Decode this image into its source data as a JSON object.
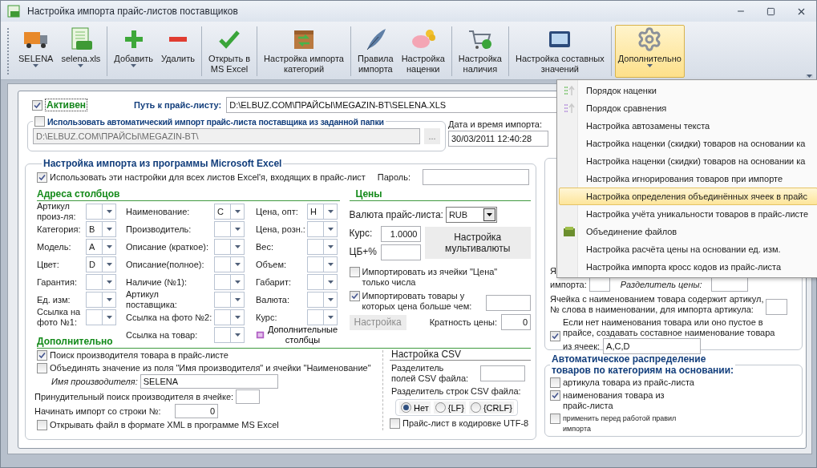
{
  "window": {
    "title": "Настройка импорта прайс-листов поставщиков"
  },
  "toolbar": [
    {
      "kind": "button",
      "label": "SELENA",
      "dropdown": true,
      "selected": false
    },
    {
      "kind": "button",
      "label": "selena.xls",
      "dropdown": true,
      "selected": false
    },
    {
      "kind": "separator"
    },
    {
      "kind": "button",
      "label": "Добавить",
      "dropdown": true,
      "selected": false
    },
    {
      "kind": "button",
      "label": "Удалить",
      "dropdown": false,
      "selected": false
    },
    {
      "kind": "separator"
    },
    {
      "kind": "button",
      "label": "Открыть в\nMS Excel",
      "dropdown": false,
      "selected": false
    },
    {
      "kind": "separator"
    },
    {
      "kind": "button",
      "label": "Настройка импорта\nкатегорий",
      "dropdown": false,
      "selected": false
    },
    {
      "kind": "separator"
    },
    {
      "kind": "button",
      "label": "Правила\nимпорта",
      "dropdown": false,
      "selected": false
    },
    {
      "kind": "button",
      "label": "Настройка\nнаценки",
      "dropdown": false,
      "selected": false
    },
    {
      "kind": "separator"
    },
    {
      "kind": "button",
      "label": "Настройка\nналичия",
      "dropdown": false,
      "selected": false
    },
    {
      "kind": "separator"
    },
    {
      "kind": "button",
      "label": "Настройка составных\nзначений",
      "dropdown": false,
      "selected": false
    },
    {
      "kind": "separator"
    },
    {
      "kind": "button",
      "label": "Дополнительно",
      "dropdown": true,
      "selected": true
    }
  ],
  "active": {
    "label": "Активен",
    "checked": true
  },
  "path": {
    "label": "Путь к прайс-листу:",
    "value": "D:\\ELBUZ.COM\\ПРАЙСЫ\\MEGAZIN-BT\\SELENA.XLS"
  },
  "auto_import": {
    "label": "Использовать автоматический импорт прайс-листа поставщика из заданной папки",
    "checked": false,
    "folder": "D:\\ELBUZ.COM\\ПРАЙСЫ\\MEGAZIN-BT\\",
    "browse": "...",
    "date_label": "Дата и время импорта:",
    "date": "30/03/2011 12:40:28"
  },
  "excel": {
    "title": "Настройка импорта из программы Microsoft Excel",
    "all_sheets": {
      "label": "Использовать эти настройки для всех листов Excel'я, входящих в прайс-лист",
      "checked": true
    },
    "password_label": "Пароль:",
    "addresses": {
      "title": "Адреса столбцов",
      "columns": [
        [
          {
            "label": "Артикул\nпроиз-ля:"
          },
          {
            "label": "Категория:",
            "value": "B"
          },
          {
            "label": "Модель:",
            "value": "A"
          },
          {
            "label": "Цвет:",
            "value": "D"
          },
          {
            "label": "Гарантия:"
          },
          {
            "label": "Ед. изм:"
          },
          {
            "label": "Ссылка на\nфото №1:"
          }
        ],
        [
          {
            "label": "Наименование:",
            "value": "C"
          },
          {
            "label": "Производитель:"
          },
          {
            "label": "Описание (краткое):"
          },
          {
            "label": "Описание(полное):"
          },
          {
            "label": "Наличие (№1):"
          },
          {
            "label": "Артикул\nпоставщика:"
          },
          {
            "label": "Ссылка на фото №2:"
          },
          {
            "label": "Ссылка на товар:"
          }
        ],
        [
          {
            "label": "Цена, опт:",
            "value": "H"
          },
          {
            "label": "Цена, розн.:"
          },
          {
            "label": "Вес:"
          },
          {
            "label": "Объем:"
          },
          {
            "label": "Габарит:"
          },
          {
            "label": "Валюта:"
          },
          {
            "label": "Курс:"
          }
        ]
      ],
      "extra_button": "Дополнительные\nстолбцы"
    },
    "prices": {
      "title": "Цены",
      "currency_label": "Валюта прайс-листа:",
      "currency": "RUB",
      "rate_label": "Курс:",
      "rate": "1.0000",
      "cb_label": "ЦБ+%",
      "multi_button": "Настройка\nмультивалюты",
      "only_numbers": {
        "label": "Импортировать из ячейки \"Цена\"\nтолько числа",
        "checked": false
      },
      "min_price": {
        "label": "Импортировать товары у\nкоторых цена больше чем:",
        "checked": true
      },
      "settings_button": {
        "label": "Настройка",
        "disabled": true
      },
      "multiplicity_label": "Кратность цены:",
      "multiplicity": "0"
    },
    "extra": {
      "title": "Дополнительно",
      "search_maker": {
        "label": "Поиск производителя товара в прайс-листе",
        "checked": true
      },
      "merge": {
        "label": "Объединять значение из поля \"Имя производителя\" и ячейки \"Наименование\"",
        "checked": false
      },
      "maker_label": "Имя производителя:",
      "maker": "SELENA",
      "forced_label": "Принудительный поиск производителя в ячейке:",
      "start_row_label": "Начинать импорт со строки №:",
      "start_row": "0",
      "open_xml": {
        "label": "Открывать файл в формате XML в программе MS Excel",
        "checked": false
      },
      "csv": {
        "title": "Настройка CSV",
        "field_sep_label": "Разделитель\nполей CSV файла:",
        "row_sep_label": "Разделитель строк CSV файла:",
        "row_sep": [
          {
            "label": "Нет",
            "selected": true
          },
          {
            "label": "{LF}",
            "selected": false
          },
          {
            "label": "{CRLF}",
            "selected": false
          }
        ],
        "utf8": {
          "label": "Прайс-лист в кодировке UTF-8",
          "checked": false
        }
      }
    }
  },
  "right": {
    "fragment": "Я",
    "import_label": "импорта:",
    "price_sep_label": "Разделитель цены:",
    "article_label": "Ячейка с наименованием товара содержит артикул,\n№ слова в наименовании, для импорта артикула:",
    "composite": {
      "label": "Если нет наименования товара или оно пустое в\nпрайсе, создавать составное наименование товара",
      "label_end": "из ячеек:",
      "checked": true,
      "value": "A,C,D"
    },
    "auto": {
      "title": "Автоматическое распределение\nтоваров по категориям на основании:",
      "options": [
        {
          "label": "артикула товара из прайс-листа",
          "checked": false,
          "small": false
        },
        {
          "label": "наименования товара из\nпрайс-листа",
          "checked": true,
          "small": false
        },
        {
          "label": "применить перед работой правил\nимпорта",
          "checked": false,
          "small": true
        }
      ]
    }
  },
  "menu": [
    {
      "label": "Порядок наценки",
      "selected": false
    },
    {
      "label": "Порядок сравнения",
      "selected": false
    },
    {
      "label": "Настройка автозамены текста",
      "selected": false
    },
    {
      "label": "Настройка наценки (скидки) товаров на основании ка",
      "selected": false
    },
    {
      "label": "Настройка наценки (скидки) товаров на основании ка",
      "selected": false
    },
    {
      "label": "Настройка игнорирования товаров при импорте",
      "selected": false
    },
    {
      "label": "Настройка определения объединённых ячеек в прайс",
      "selected": true
    },
    {
      "label": "Настройка учёта уникальности товаров в прайс-листе",
      "selected": false
    },
    {
      "label": "Объединение файлов",
      "selected": false
    },
    {
      "label": "Настройка расчёта цены на основании ед. изм.",
      "selected": false
    },
    {
      "label": "Настройка импорта кросс кодов из прайс-листа",
      "selected": false
    }
  ]
}
